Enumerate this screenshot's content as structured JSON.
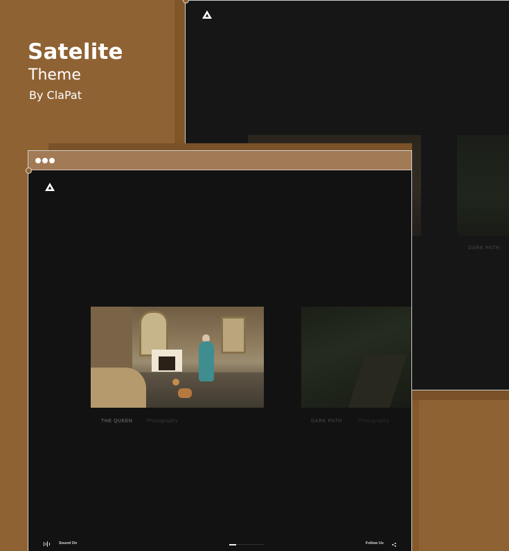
{
  "promo": {
    "title": "Satelite",
    "subtitle": "Theme",
    "author": "By ClaPat"
  },
  "back_window": {
    "caption_dark_path": "DARK PATH"
  },
  "front_window": {
    "titlebar_dots": 3,
    "projects": [
      {
        "title": "THE QUEEN",
        "category": "Photography"
      },
      {
        "title": "DARK PATH",
        "category": "Photography"
      }
    ],
    "bottom_bar": {
      "sound_label": "Sound On",
      "follow_label": "Follow Us",
      "slider_progress_fraction": 0.2
    }
  },
  "colors": {
    "background": "#8f6233",
    "titlebar": "#a27a55",
    "window_bg": "#121212",
    "text_white": "#ffffff"
  },
  "icons": [
    "logo-triangle-icon",
    "sound-wave-icon",
    "share-icon"
  ]
}
